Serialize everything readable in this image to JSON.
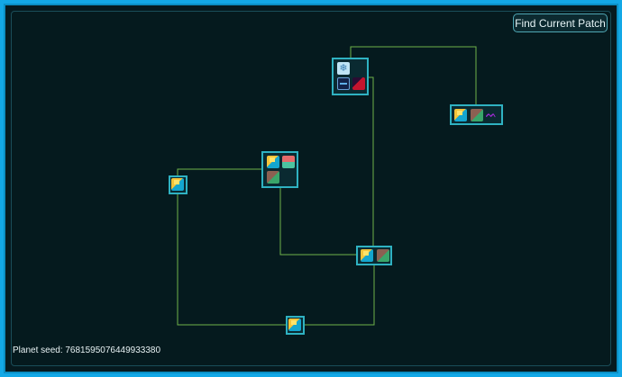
{
  "find_button": {
    "label": "Find Current Patch"
  },
  "seed": {
    "label": "Planet seed: 7681595076449933380"
  },
  "colors": {
    "background": "#061a1f",
    "frame": "#13a8e6",
    "connector": "#6fb24a",
    "node_border": "#2fb2c2"
  },
  "nodes": [
    {
      "id": "top",
      "icons": [
        "snowflake-icon",
        "deep-sea-icon",
        "vent-icon"
      ]
    },
    {
      "id": "right",
      "icons": [
        "shallow-sea-icon",
        "mud-icon",
        "purple-icon"
      ]
    },
    {
      "id": "middle",
      "icons": [
        "shallow-sea-icon",
        "wave-icon",
        "mud-icon"
      ]
    },
    {
      "id": "left",
      "icons": [
        "shallow-sea-icon"
      ]
    },
    {
      "id": "lower-right",
      "icons": [
        "shallow-sea-icon",
        "mud-icon"
      ]
    },
    {
      "id": "bottom",
      "icons": [
        "shallow-sea-icon"
      ]
    }
  ]
}
